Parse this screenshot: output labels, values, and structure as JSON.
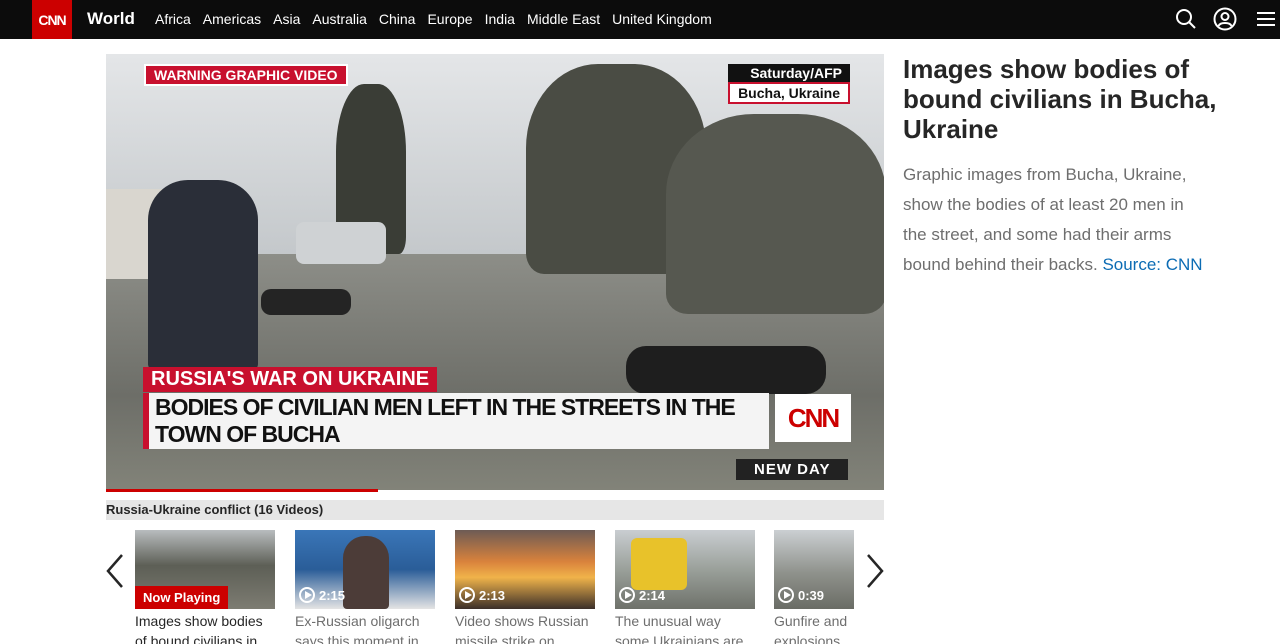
{
  "nav": {
    "logo": "CNN",
    "section": "World",
    "links": [
      "Africa",
      "Americas",
      "Asia",
      "Australia",
      "China",
      "Europe",
      "India",
      "Middle East",
      "United Kingdom"
    ],
    "icons": [
      "search-icon",
      "account-icon",
      "menu-icon"
    ]
  },
  "player": {
    "warning": "WARNING GRAPHIC VIDEO",
    "credit_line1": "Saturday/AFP",
    "credit_line2": "Bucha, Ukraine",
    "banner_topic": "RUSSIA'S WAR ON UKRAINE",
    "banner_headline": "BODIES OF CIVILIAN MEN LEFT IN THE STREETS IN THE TOWN OF BUCHA",
    "bug": "CNN",
    "show": "NEW DAY",
    "progress": 0.35
  },
  "playlist": {
    "title": "Russia-Ukraine conflict (16 Videos)"
  },
  "article": {
    "headline": "Images show bodies of bound civilians in Bucha, Ukraine",
    "description": "Graphic images from Bucha, Ukraine, show the bodies of at least 20 men in the street, and some had their arms bound behind their backs.",
    "source_link": "Source: CNN"
  },
  "carousel": {
    "items": [
      {
        "status": "Now Playing",
        "caption": "Images show bodies of bound civilians in"
      },
      {
        "duration": "2:15",
        "caption": "Ex-Russian oligarch says this moment in"
      },
      {
        "duration": "2:13",
        "caption": "Video shows Russian missile strike on"
      },
      {
        "duration": "2:14",
        "caption": "The unusual way some Ukrainians are"
      },
      {
        "duration": "0:39",
        "caption": "Gunfire and explosions di"
      }
    ]
  },
  "colors": {
    "brand_red": "#cc0000",
    "nav_bg": "#0c0c0c",
    "link_blue": "#0c6cb4"
  }
}
